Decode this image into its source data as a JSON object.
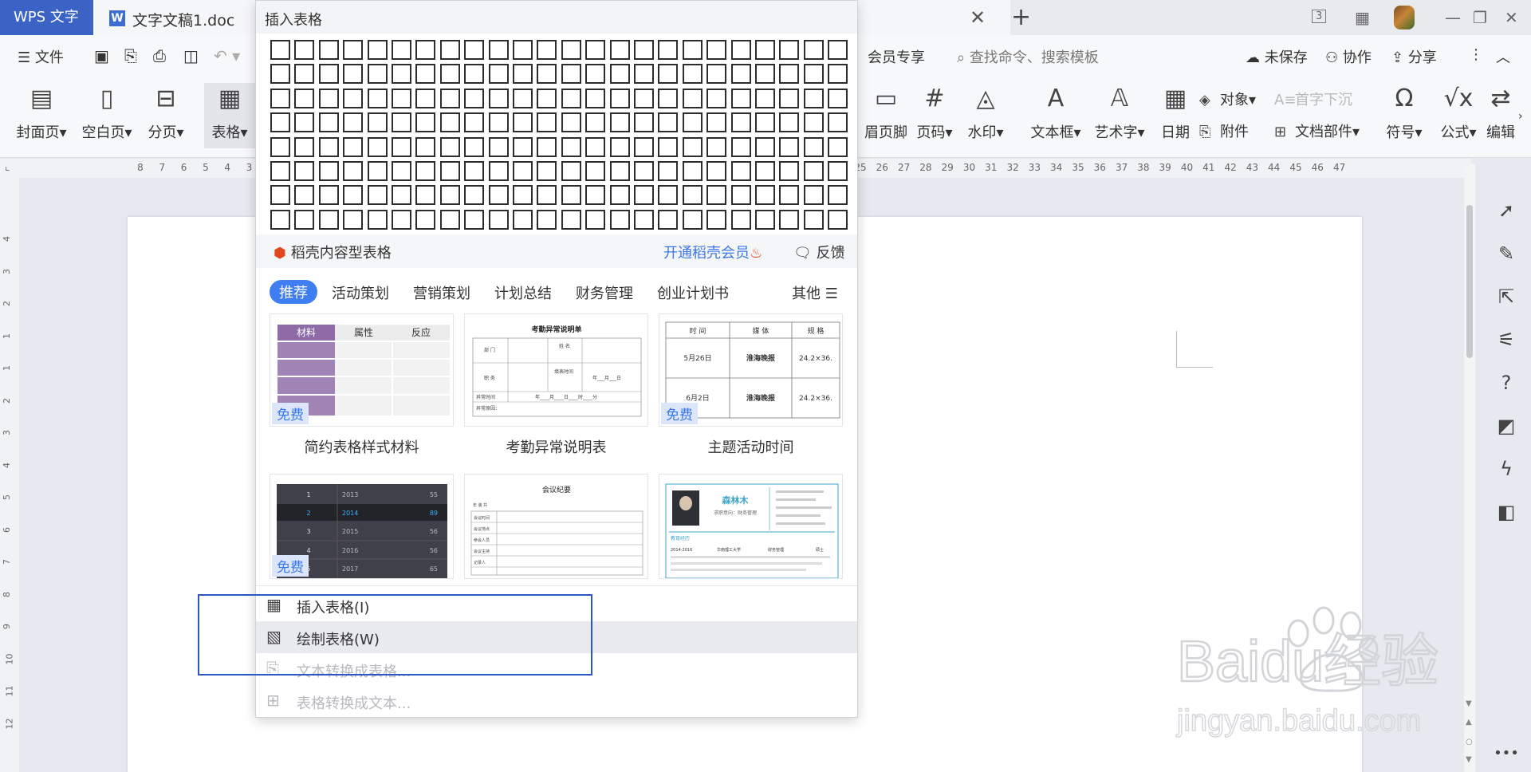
{
  "titlebar": {
    "app_name": "WPS 文字",
    "doc_icon": "W",
    "doc_name": "文字文稿1.doc",
    "close_glyph": "✕",
    "new_glyph": "+",
    "icons": [
      "page-count-icon",
      "grid-apps-icon",
      "avatar",
      "minimize-icon",
      "restore-icon",
      "close-window-icon"
    ]
  },
  "menubar": {
    "file": "文件",
    "vip": "会员专享",
    "search_placeholder": "查找命令、搜索模板",
    "unsaved": "未保存",
    "collab": "协作",
    "share": "分享"
  },
  "ribbon": {
    "cover": "封面页",
    "blank": "空白页",
    "pagebreak": "分页",
    "table": "表格",
    "header_footer": "眉页脚",
    "page_num": "页码",
    "watermark": "水印",
    "textbox": "文本框",
    "wordart": "艺术字",
    "date": "日期",
    "object": "对象",
    "attachment": "附件",
    "dropcap": "首字下沉",
    "docpart": "文档部件",
    "symbol": "符号",
    "formula": "公式",
    "edit": "编辑"
  },
  "ruler": {
    "left_nums": [
      "8",
      "7",
      "6",
      "5",
      "4",
      "3"
    ],
    "right_nums": [
      "25",
      "26",
      "27",
      "28",
      "29",
      "30",
      "31",
      "32",
      "33",
      "34",
      "35",
      "36",
      "37",
      "38",
      "39",
      "40",
      "41",
      "42",
      "43",
      "44",
      "45",
      "46",
      "47"
    ],
    "vert_nums": [
      "4",
      "3",
      "2",
      "1",
      "1",
      "2",
      "3",
      "4",
      "5",
      "6",
      "7",
      "8",
      "9",
      "10",
      "11",
      "12"
    ]
  },
  "dropdown": {
    "title": "插入表格",
    "grid": {
      "cols": 24,
      "rows": 8
    },
    "daoke": {
      "label": "稻壳内容型表格",
      "vip_link": "开通稻壳会员",
      "feedback": "反馈"
    },
    "categories": [
      "推荐",
      "活动策划",
      "营销策划",
      "计划总结",
      "财务管理",
      "创业计划书"
    ],
    "more": "其他",
    "free_badge": "免费",
    "templates": [
      {
        "caption": "简约表格样式材料",
        "free": true,
        "headers": [
          "材料",
          "属性",
          "反应"
        ]
      },
      {
        "caption": "考勤异常说明表",
        "free": false,
        "title": "考勤异常说明单",
        "fields": [
          "部 门",
          "姓 名",
          "职 务",
          "填表时间",
          "年___月___日",
          "异常时间",
          "年____月____日____时____分",
          "异常原因："
        ]
      },
      {
        "caption": "主题活动时间",
        "free": true,
        "headers": [
          "时 间",
          "媒 体",
          "规 格"
        ],
        "rows": [
          [
            "5月26日",
            "淮海晚报",
            "24.2×36."
          ],
          [
            "6月2日",
            "淮海晚报",
            "24.2×36."
          ]
        ]
      },
      {
        "caption": "",
        "free": true,
        "rows": [
          [
            "1",
            "2013",
            "55"
          ],
          [
            "2",
            "2014",
            "89"
          ],
          [
            "3",
            "2015",
            "56"
          ],
          [
            "4",
            "2016",
            "56"
          ],
          [
            "5",
            "2017",
            "65"
          ]
        ]
      },
      {
        "caption": "",
        "free": false,
        "title": "会议纪要",
        "fields": [
          "年 装 共",
          "会议时间",
          "会议地点",
          "参会人员",
          "会议主持",
          "记录人"
        ]
      },
      {
        "caption": "",
        "free": false,
        "name": "森林木",
        "job": "求职意向：财务管理",
        "section": "教育经历",
        "edu": [
          "2014-2016",
          "华南理工大学",
          "财务管理",
          "硕士"
        ]
      }
    ],
    "menu": [
      {
        "label": "插入表格(I)",
        "icon": "table-icon",
        "disabled": false
      },
      {
        "label": "绘制表格(W)",
        "icon": "draw-table-icon",
        "disabled": false
      },
      {
        "label": "文本转换成表格...",
        "icon": "text-to-table-icon",
        "disabled": true
      },
      {
        "label": "表格转换成文本...",
        "icon": "table-to-text-icon",
        "disabled": true
      }
    ]
  },
  "watermark": {
    "main": "Baidu经验",
    "sub": "jingyan.baidu.com"
  },
  "colors": {
    "accent": "#3b63c6",
    "link": "#3b78e7",
    "selection_box": "#2c57c3",
    "flame": "#e2481d"
  }
}
